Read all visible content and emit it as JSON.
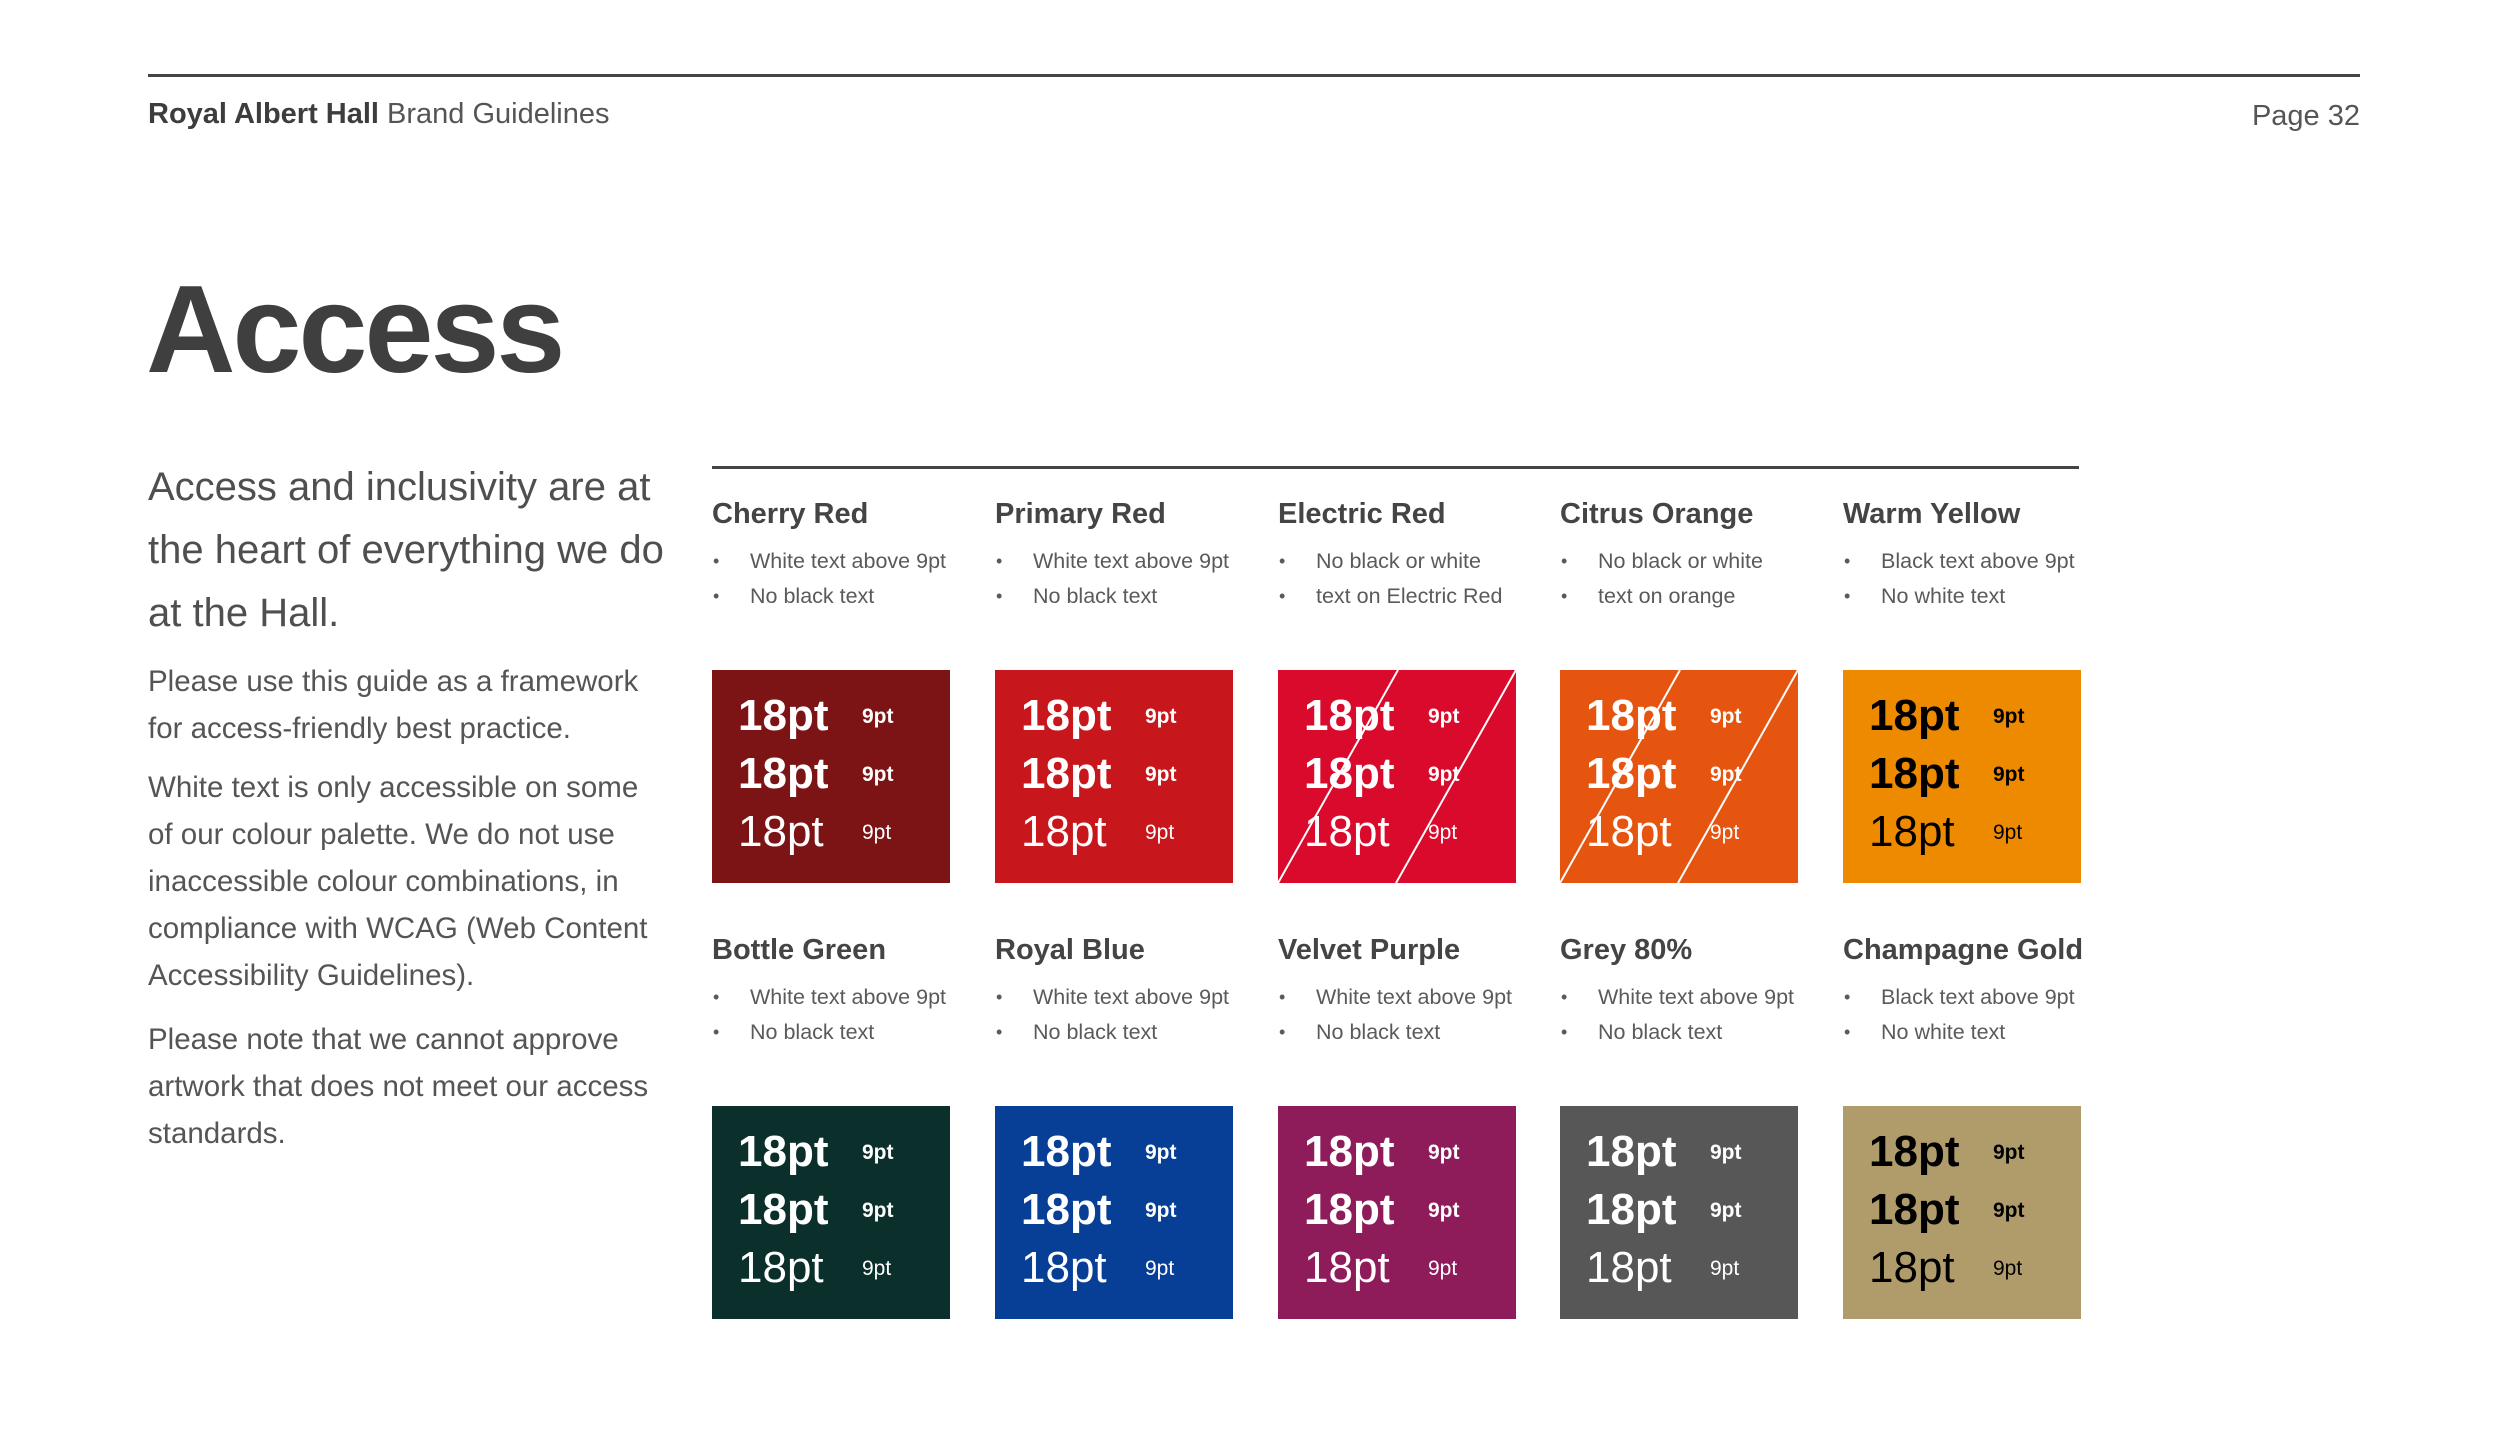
{
  "header": {
    "brand_bold": "Royal Albert Hall",
    "brand_rest": " Brand Guidelines",
    "page": "Page 32"
  },
  "title": "Access",
  "intro": "Access and inclusivity are at the heart of everything we do at the Hall.",
  "paragraphs": [
    "Please use this guide as a framework for access-friendly best practice.",
    "White text is only accessible on some of our colour palette. We do not use inaccessible colour combinations, in compliance with WCAG (Web Content Accessibility Guidelines).",
    "Please note that we cannot approve artwork that does not meet our access standards."
  ],
  "samples": {
    "big": "18pt",
    "small": "9pt"
  },
  "colours": [
    {
      "name": "Cherry Red",
      "hex": "#7c1416",
      "text_color": "#ffffff",
      "crossed": false,
      "bullets": [
        "White text above 9pt",
        "No black text"
      ]
    },
    {
      "name": "Primary Red",
      "hex": "#c8171c",
      "text_color": "#ffffff",
      "crossed": false,
      "bullets": [
        "White text above 9pt",
        "No black text"
      ]
    },
    {
      "name": "Electric Red",
      "hex": "#d90a2c",
      "text_color": "#ffffff",
      "crossed": true,
      "bullets": [
        "No black or white",
        "text on Electric Red"
      ]
    },
    {
      "name": "Citrus Orange",
      "hex": "#e6550f",
      "text_color": "#ffffff",
      "crossed": true,
      "bullets": [
        "No black or white",
        "text on orange"
      ]
    },
    {
      "name": "Warm Yellow",
      "hex": "#ee8a00",
      "text_color": "#000000",
      "crossed": false,
      "bullets": [
        "Black text above 9pt",
        "No white text"
      ]
    },
    {
      "name": "Bottle Green",
      "hex": "#0b2f2a",
      "text_color": "#ffffff",
      "crossed": false,
      "bullets": [
        "White text above 9pt",
        "No black text"
      ]
    },
    {
      "name": "Royal Blue",
      "hex": "#073f97",
      "text_color": "#ffffff",
      "crossed": false,
      "bullets": [
        "White text above 9pt",
        "No black text"
      ]
    },
    {
      "name": "Velvet Purple",
      "hex": "#8f1c5a",
      "text_color": "#ffffff",
      "crossed": false,
      "bullets": [
        "White text above 9pt",
        "No black text"
      ]
    },
    {
      "name": "Grey 80%",
      "hex": "#575757",
      "text_color": "#ffffff",
      "crossed": false,
      "bullets": [
        "White text above 9pt",
        "No black text"
      ]
    },
    {
      "name": "Champagne Gold",
      "hex": "#b09c6a",
      "text_color": "#000000",
      "crossed": false,
      "bullets": [
        "Black text above 9pt",
        "No white text"
      ]
    }
  ]
}
